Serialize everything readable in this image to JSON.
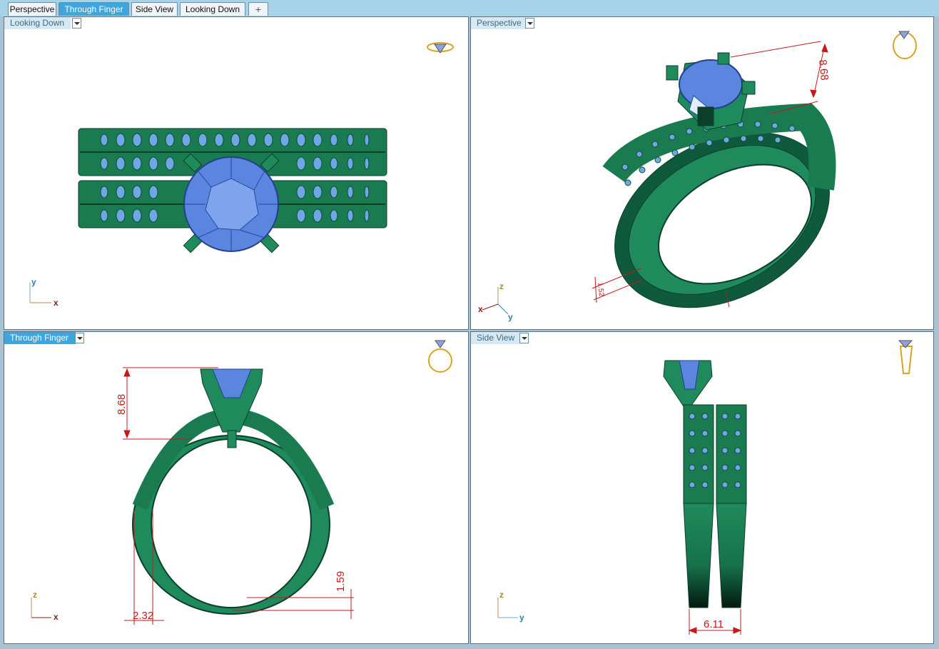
{
  "tabs": [
    {
      "label": "Perspective"
    },
    {
      "label": "Through Finger"
    },
    {
      "label": "Side View"
    },
    {
      "label": "Looking Down"
    }
  ],
  "add_tab_label": "+",
  "active_tab": "Through Finger",
  "viewports": {
    "top_left": {
      "label": "Looking Down",
      "axis_v": "y",
      "axis_h": "x"
    },
    "top_right": {
      "label": "Perspective",
      "axis_v": "z",
      "axis_h": "x",
      "axis_d": "y",
      "dim_height": "8.68",
      "dim_small": "1.52"
    },
    "bottom_left": {
      "label": "Through Finger",
      "axis_v": "z",
      "axis_h": "x",
      "dim_height": "8.68",
      "dim_width": "2.32",
      "dim_thick": "1.59"
    },
    "bottom_right": {
      "label": "Side View",
      "axis_v": "z",
      "axis_h": "y",
      "dim_width": "6.11"
    }
  },
  "colors": {
    "metal": "#1f8a5c",
    "metal_dark": "#0b3f2a",
    "gem": "#5a86e0",
    "dimension": "#c41a1a",
    "tab_active": "#3ea6dc"
  }
}
